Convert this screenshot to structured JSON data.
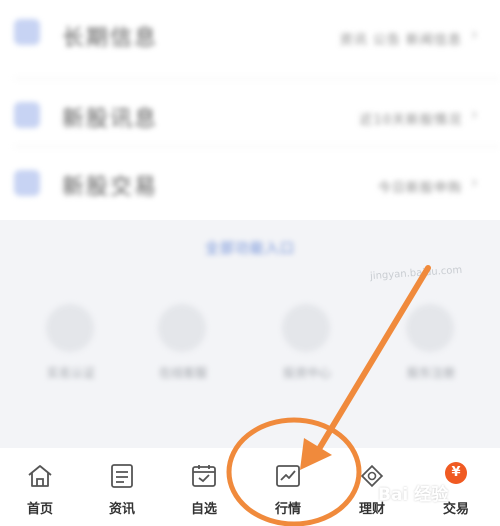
{
  "list": {
    "rows": [
      {
        "title": "长期信息",
        "right": "资讯  公告  新闻信息"
      },
      {
        "title": "新股讯息",
        "right": "近10天新股情况"
      },
      {
        "title": "新股交易",
        "right": "今日新股申购"
      }
    ]
  },
  "center_link": "全部功能入口",
  "grid_items": [
    {
      "label": "实名认证",
      "icon": "phone-icon"
    },
    {
      "label": "在线客服",
      "icon": "chat-icon"
    },
    {
      "label": "投资中心",
      "icon": "user-icon"
    },
    {
      "label": "股东注册",
      "icon": "id-icon"
    }
  ],
  "watermark": "jingyan.baidu.com",
  "baidu_mark": "Bai  经验",
  "tabs": [
    {
      "label": "首页",
      "icon": "home-icon"
    },
    {
      "label": "资讯",
      "icon": "news-icon"
    },
    {
      "label": "自选",
      "icon": "watchlist-icon"
    },
    {
      "label": "行情",
      "icon": "market-chart-icon"
    },
    {
      "label": "理财",
      "icon": "wealth-icon"
    },
    {
      "label": "交易",
      "icon": "trade-icon",
      "badge": "¥"
    }
  ],
  "colors": {
    "annotation": "#f08a3c",
    "trade_badge": "#f05a22",
    "link": "#6f8fd8"
  }
}
